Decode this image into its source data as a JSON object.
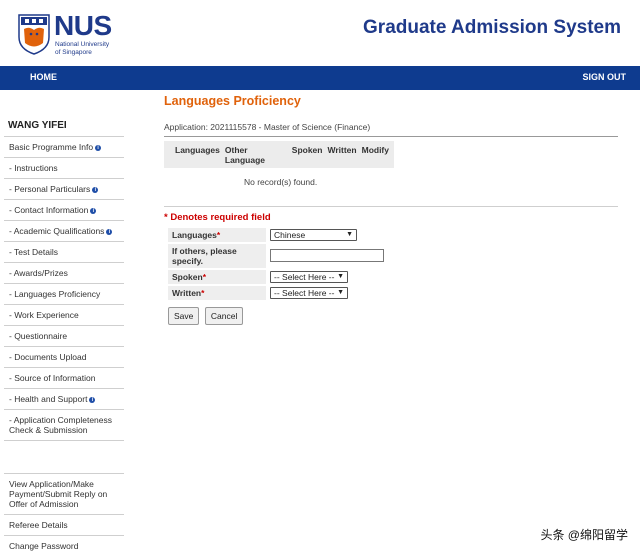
{
  "brand": {
    "logo_text": "NUS",
    "logo_sub1": "National University",
    "logo_sub2": "of Singapore",
    "system_title": "Graduate Admission System",
    "navy": "#1f3a8a"
  },
  "nav": {
    "home": "HOME",
    "sign_out": "SIGN OUT",
    "bar_color": "#0e3b8f"
  },
  "sidebar": {
    "user_name": "WANG YIFEI",
    "items": [
      {
        "label": "Basic Programme Info",
        "info": true
      },
      {
        "label": "- Instructions",
        "info": false
      },
      {
        "label": "- Personal Particulars",
        "info": true
      },
      {
        "label": "- Contact Information",
        "info": true
      },
      {
        "label": "- Academic Qualifications",
        "info": true
      },
      {
        "label": "- Test Details",
        "info": false
      },
      {
        "label": "- Awards/Prizes",
        "info": false
      },
      {
        "label": "- Languages Proficiency",
        "info": false
      },
      {
        "label": "- Work Experience",
        "info": false
      },
      {
        "label": "- Questionnaire",
        "info": false
      },
      {
        "label": "- Documents Upload",
        "info": false
      },
      {
        "label": "- Source of Information",
        "info": false
      },
      {
        "label": "- Health and Support",
        "info": true
      },
      {
        "label": "- Application Completeness Check & Submission",
        "info": false
      }
    ],
    "bottom_items": [
      {
        "label": "View Application/Make Payment/Submit Reply on Offer of Admission"
      },
      {
        "label": "Referee Details"
      },
      {
        "label": "Change Password"
      }
    ],
    "info_icon_text": "i"
  },
  "main": {
    "title": "Languages Proficiency",
    "title_color": "#e0620b",
    "application_line": "Application: 2021115578 - Master of Science (Finance)",
    "columns": [
      "Languages",
      "Other Language",
      "Spoken",
      "Written",
      "Modify"
    ],
    "no_record": "No record(s) found.",
    "required_note": "* Denotes required field",
    "form": {
      "languages_label": "Languages",
      "languages_value": "Chinese",
      "others_label": "If others, please specify.",
      "others_value": "",
      "spoken_label": "Spoken",
      "spoken_value": "-- Select Here --",
      "written_label": "Written",
      "written_value": "-- Select Here --",
      "required_mark": "*"
    },
    "buttons": {
      "save": "Save",
      "cancel": "Cancel"
    }
  },
  "watermark": "头条 @绵阳留学"
}
